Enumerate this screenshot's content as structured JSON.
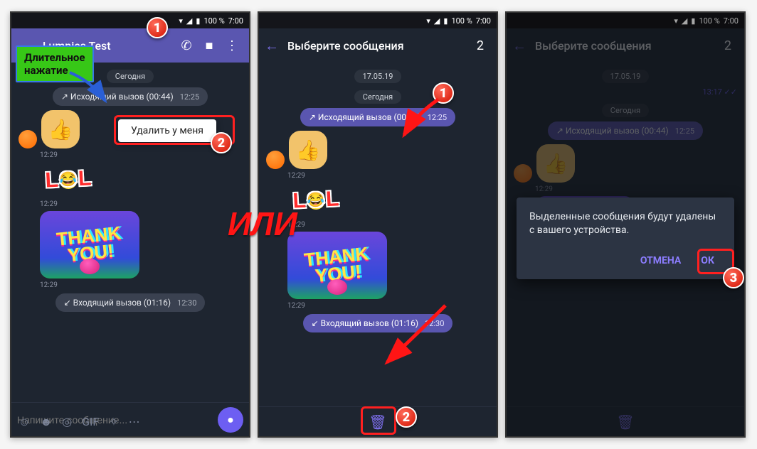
{
  "status": {
    "battery": "100 %",
    "time": "7:00"
  },
  "annotations": {
    "long_press": "Длительное\nнажатие",
    "context_delete": "Удалить у меня",
    "or": "ИЛИ"
  },
  "appbar1": {
    "contact": "Lumpics Test"
  },
  "appbar_select": {
    "title": "Выберите сообщения",
    "count": "2"
  },
  "chat": {
    "date_prev": "17.05.19",
    "prev_time": "13:17",
    "date_today": "Сегодня",
    "outgoing_call": "↗ Исходящий вызов  (00:44)",
    "outgoing_time": "12:25",
    "t1": "12:29",
    "t2": "12:29",
    "t3": "12:29",
    "incoming_call": "↙ Входящий вызов  (01:16)",
    "incoming_time": "12:30",
    "thankyou": "THANK YOU!"
  },
  "composer": {
    "placeholder": "Напишите сообщение..."
  },
  "dialog": {
    "text": "Выделенные сообщения будут удалены с вашего устройства.",
    "cancel": "ОТМЕНА",
    "ok": "ОК"
  }
}
